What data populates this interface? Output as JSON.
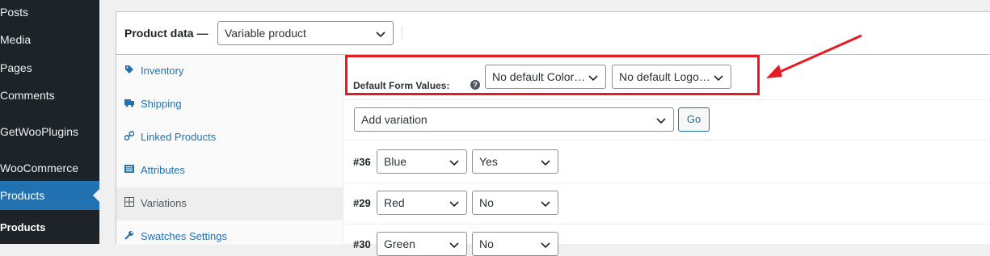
{
  "admin_menu": {
    "items": [
      {
        "label": "Posts"
      },
      {
        "label": "Media"
      },
      {
        "label": "Pages"
      },
      {
        "label": "Comments"
      },
      {
        "label": "GetWooPlugins"
      },
      {
        "label": "WooCommerce"
      },
      {
        "label": "Products",
        "current": true
      }
    ],
    "submenu_first": "Products"
  },
  "product_data": {
    "title": "Product data —",
    "type_select_value": "Variable product"
  },
  "tabs": [
    {
      "label": "Inventory",
      "icon": "tag-icon"
    },
    {
      "label": "Shipping",
      "icon": "truck-icon"
    },
    {
      "label": "Linked Products",
      "icon": "link-icon"
    },
    {
      "label": "Attributes",
      "icon": "list-icon"
    },
    {
      "label": "Variations",
      "icon": "grid-icon",
      "active": true
    },
    {
      "label": "Swatches Settings",
      "icon": "wrench-icon"
    }
  ],
  "defaults": {
    "label": "Default Form Values:",
    "help": "?",
    "color_select": "No default Color…",
    "logo_select": "No default Logo…"
  },
  "add_variation": {
    "select_value": "Add variation",
    "go_label": "Go"
  },
  "variations": [
    {
      "id": "#36",
      "color": "Blue",
      "logo": "Yes"
    },
    {
      "id": "#29",
      "color": "Red",
      "logo": "No"
    },
    {
      "id": "#30",
      "color": "Green",
      "logo": "No"
    }
  ],
  "colors": {
    "highlight": "#e31b23",
    "accent": "#2271b1",
    "sidebar": "#1d2327"
  }
}
